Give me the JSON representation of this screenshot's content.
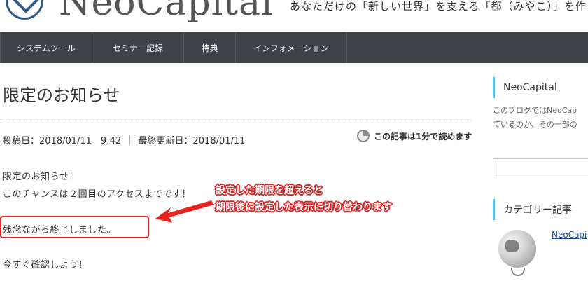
{
  "header": {
    "logo_text": "NeoCapital",
    "tagline": "あなただけの「新しい世界」を支える「都（みやこ）」を作"
  },
  "nav": {
    "items": [
      {
        "label": "システムツール"
      },
      {
        "label": "セミナー記録"
      },
      {
        "label": "特典"
      },
      {
        "label": "インフォメーション"
      }
    ]
  },
  "post": {
    "title": "限定のお知らせ",
    "posted_label": "投稿日：2018/01/11　9:42",
    "separator": "|",
    "updated_label": "最終更新日：2018/01/11",
    "read_time": "この記事は1分で読めます",
    "lines": [
      "限定のお知らせ！",
      "このチャンスは２回目のアクセスまでです！",
      "残念ながら終了しました。",
      "今すぐ確認しよう！"
    ]
  },
  "annotation": {
    "line1": "設定した期限を超えると",
    "line2": "期限後に設定した表示に切り替わります",
    "color": "#e02020"
  },
  "sidebar": {
    "widget1_title": "NeoCapital",
    "widget1_text1": "このブログではNeoCap",
    "widget1_text2": "ているのか、その一部の",
    "widget2_title": "カテゴリー記事",
    "link_text": "NeoCapi",
    "accent_color": "#5bc0de"
  }
}
